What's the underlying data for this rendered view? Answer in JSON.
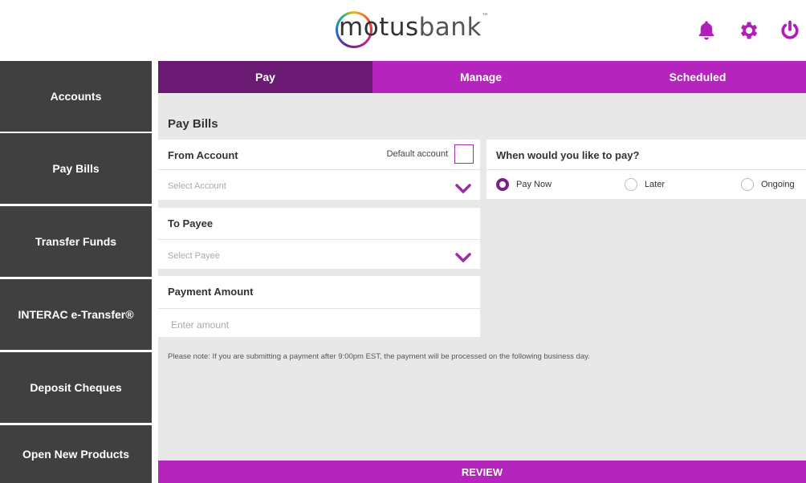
{
  "brand": {
    "name_bold": "motus",
    "name_light": "bank",
    "tm": "™"
  },
  "header_icons": [
    "bell-icon",
    "gear-icon",
    "power-icon"
  ],
  "colors": {
    "purple": "#b525bd",
    "dark_purple": "#6a1a73",
    "sidebar": "#404041",
    "background": "#e8e8e9"
  },
  "sidebar": {
    "items": [
      {
        "label": "Accounts"
      },
      {
        "label": "Pay Bills"
      },
      {
        "label": "Transfer Funds"
      },
      {
        "label": "INTERAC e-Transfer®"
      },
      {
        "label": "Deposit Cheques"
      },
      {
        "label": "Open New Products"
      }
    ]
  },
  "tabs": [
    {
      "label": "Pay",
      "active": true
    },
    {
      "label": "Manage",
      "active": false
    },
    {
      "label": "Scheduled",
      "active": false
    }
  ],
  "page": {
    "title": "Pay Bills"
  },
  "from_account": {
    "label": "From Account",
    "default_label": "Default account",
    "placeholder": "Select Account"
  },
  "payee": {
    "label": "To Payee",
    "placeholder": "Select Payee"
  },
  "amount": {
    "label": "Payment Amount",
    "placeholder": "Enter amount"
  },
  "when": {
    "label": "When would you like to pay?",
    "options": [
      {
        "label": "Pay Now",
        "selected": true
      },
      {
        "label": "Later",
        "selected": false
      },
      {
        "label": "Ongoing",
        "selected": false
      }
    ]
  },
  "note": "Please note: If you are submitting a payment after 9:00pm EST, the payment will be processed on the following business day.",
  "review_label": "REVIEW"
}
